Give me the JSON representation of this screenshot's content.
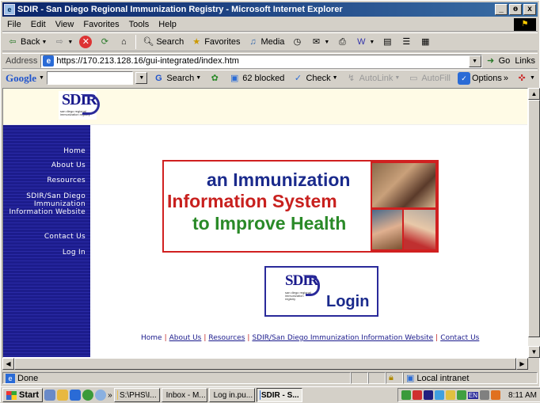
{
  "window": {
    "title": "SDIR - San Diego Regional Immunization Registry - Microsoft Internet Explorer",
    "controls": [
      "_",
      "ɵ",
      "x"
    ]
  },
  "menu": [
    "File",
    "Edit",
    "View",
    "Favorites",
    "Tools",
    "Help"
  ],
  "toolbar": {
    "back": "Back",
    "search": "Search",
    "favorites": "Favorites",
    "media": "Media"
  },
  "address": {
    "label": "Address",
    "url": "https://170.213.128.16/gui-integrated/index.htm",
    "go": "Go",
    "links": "Links"
  },
  "google": {
    "logo": "Google",
    "search": "Search",
    "blocked": "62 blocked",
    "check": "Check",
    "autolink": "AutoLink",
    "autofill": "AutoFill",
    "options": "Options"
  },
  "page": {
    "logo_text": "SDIR",
    "logo_sub": "san diego regional immunization registry",
    "nav": [
      "Home",
      "About Us",
      "Resources",
      "SDIR/San Diego Immunization Information Website",
      "Contact Us",
      "Log In"
    ],
    "banner": [
      "an Immunization",
      "Information System",
      "to Improve Health"
    ],
    "login_label": "Login",
    "footer": [
      "Home",
      "About Us",
      "Resources",
      "SDIR/San Diego Immunization Information Website",
      "Contact Us"
    ]
  },
  "status": {
    "text": "Done",
    "zone": "Local intranet"
  },
  "taskbar": {
    "start": "Start",
    "tasks": [
      "S:\\PHS\\I...",
      "Inbox - M...",
      "Log in.pu...",
      "SDIR - S..."
    ],
    "clock": "8:11 AM",
    "lang": "EN"
  }
}
